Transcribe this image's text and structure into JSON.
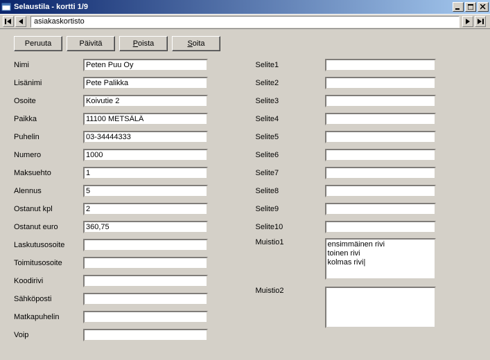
{
  "window": {
    "title": "Selaustila - kortti 1/9"
  },
  "nav": {
    "value": "asiakaskortisto"
  },
  "toolbar": {
    "peruuta": "Peruuta",
    "paivita": "Päivitä",
    "poista": "Poista",
    "soita": "Soita"
  },
  "left": {
    "nimi": {
      "label": "Nimi",
      "value": "Peten Puu Oy"
    },
    "lisanimi": {
      "label": "Lisänimi",
      "value": "Pete Palikka"
    },
    "osoite": {
      "label": "Osoite",
      "value": "Koivutie 2"
    },
    "paikka": {
      "label": "Paikka",
      "value": "11100 METSÄLÄ"
    },
    "puhelin": {
      "label": "Puhelin",
      "value": "03-34444333"
    },
    "numero": {
      "label": "Numero",
      "value": "1000"
    },
    "maksuehto": {
      "label": "Maksuehto",
      "value": "1"
    },
    "alennus": {
      "label": "Alennus",
      "value": "5"
    },
    "ostanut_kpl": {
      "label": "Ostanut kpl",
      "value": "2"
    },
    "ostanut_euro": {
      "label": "Ostanut euro",
      "value": "360,75"
    },
    "laskutusosoite": {
      "label": "Laskutusosoite",
      "value": ""
    },
    "toimitusosoite": {
      "label": "Toimitusosoite",
      "value": ""
    },
    "koodirivi": {
      "label": "Koodirivi",
      "value": ""
    },
    "sahkoposti": {
      "label": "Sähköposti",
      "value": ""
    },
    "matkapuhelin": {
      "label": "Matkapuhelin",
      "value": ""
    },
    "voip": {
      "label": "Voip",
      "value": ""
    }
  },
  "right": {
    "selite1": {
      "label": "Selite1",
      "value": ""
    },
    "selite2": {
      "label": "Selite2",
      "value": ""
    },
    "selite3": {
      "label": "Selite3",
      "value": ""
    },
    "selite4": {
      "label": "Selite4",
      "value": ""
    },
    "selite5": {
      "label": "Selite5",
      "value": ""
    },
    "selite6": {
      "label": "Selite6",
      "value": ""
    },
    "selite7": {
      "label": "Selite7",
      "value": ""
    },
    "selite8": {
      "label": "Selite8",
      "value": ""
    },
    "selite9": {
      "label": "Selite9",
      "value": ""
    },
    "selite10": {
      "label": "Selite10",
      "value": ""
    },
    "muistio1": {
      "label": "Muistio1",
      "value": "ensimmäinen rivi\ntoinen rivi\nkolmas rivi|"
    },
    "muistio2": {
      "label": "Muistio2",
      "value": ""
    }
  }
}
